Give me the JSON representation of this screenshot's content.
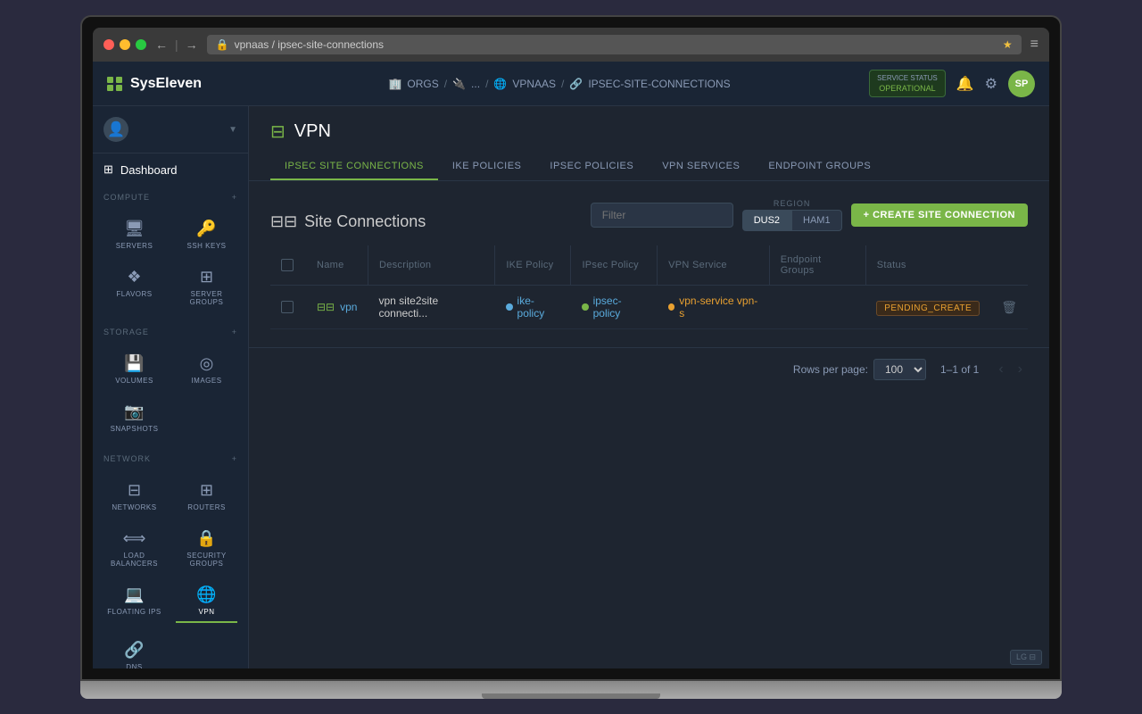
{
  "browser": {
    "back_icon": "←",
    "forward_icon": "→",
    "address": "vpnaas / ipsec-site-connections",
    "menu_icon": "≡"
  },
  "topbar": {
    "logo": "SysEleven",
    "breadcrumbs": [
      {
        "label": "ORGS",
        "icon": "🏢"
      },
      {
        "label": "...",
        "icon": "🔌"
      },
      {
        "label": "VPNAAS",
        "icon": "🌐"
      },
      {
        "label": "IPSEC-SITE-CONNECTIONS",
        "icon": "🔗"
      }
    ],
    "service_status_label": "SERVICE STATUS",
    "service_status_value": "OPERATIONAL",
    "user_initials": "SP"
  },
  "sidebar": {
    "compute_section": "COMPUTE",
    "storage_section": "STORAGE",
    "network_section": "NETWORK",
    "dashboard_label": "Dashboard",
    "items_compute": [
      {
        "label": "SERVERS",
        "icon": "🖥"
      },
      {
        "label": "SSH KEYS",
        "icon": "🔑"
      },
      {
        "label": "FLAVORS",
        "icon": "❖"
      },
      {
        "label": "SERVER GROUPS",
        "icon": "⊞"
      }
    ],
    "items_storage": [
      {
        "label": "VOLUMES",
        "icon": "💾"
      },
      {
        "label": "IMAGES",
        "icon": "◎"
      },
      {
        "label": "SNAPSHOTS",
        "icon": "📷"
      }
    ],
    "items_network": [
      {
        "label": "NETWORKS",
        "icon": "⊟"
      },
      {
        "label": "ROUTERS",
        "icon": "⊞"
      },
      {
        "label": "LOAD BALANCERS",
        "icon": "⟺"
      },
      {
        "label": "SECURITY GROUPS",
        "icon": "🔒"
      },
      {
        "label": "FLOATING IPS",
        "icon": "💻"
      },
      {
        "label": "VPN",
        "icon": "🌐",
        "active": true
      },
      {
        "label": "DNS",
        "icon": "🔗"
      }
    ]
  },
  "page": {
    "title": "VPN",
    "tabs": [
      {
        "label": "IPSEC SITE CONNECTIONS",
        "active": true
      },
      {
        "label": "IKE POLICIES"
      },
      {
        "label": "IPSEC POLICIES"
      },
      {
        "label": "VPN SERVICES"
      },
      {
        "label": "ENDPOINT GROUPS"
      }
    ]
  },
  "content": {
    "section_title": "Site Connections",
    "filter_placeholder": "Filter",
    "region_label": "REGION",
    "regions": [
      {
        "label": "DUS2",
        "active": true
      },
      {
        "label": "HAM1"
      }
    ],
    "create_button": "+ CREATE SITE CONNECTION",
    "table_headers": [
      "Name",
      "Description",
      "IKE Policy",
      "IPsec Policy",
      "VPN Service",
      "Endpoint Groups",
      "Status"
    ],
    "rows": [
      {
        "name": "vpn",
        "description": "vpn site2site connecti...",
        "ike_policy": "ike-policy",
        "ipsec_policy": "ipsec-policy",
        "vpn_service": "vpn-service vpn-s",
        "endpoint_groups": "",
        "status": "PENDING_CREATE"
      }
    ],
    "pagination": {
      "rows_per_page_label": "Rows per page:",
      "rows_count": "100",
      "count_label": "1–1 of 1"
    }
  }
}
